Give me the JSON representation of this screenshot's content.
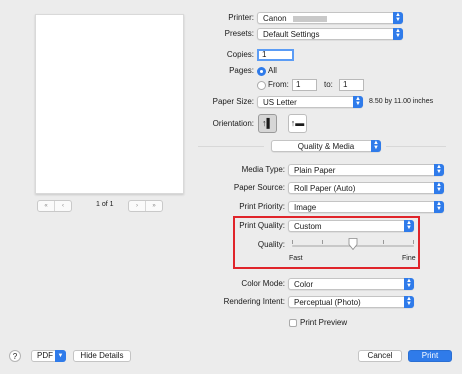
{
  "preview": {
    "page_label": "1 of 1",
    "first_glyph": "«",
    "prev_glyph": "‹",
    "next_glyph": "›",
    "last_glyph": "»"
  },
  "printer": {
    "label": "Printer:",
    "value": "Canon"
  },
  "presets": {
    "label": "Presets:",
    "value": "Default Settings"
  },
  "copies": {
    "label": "Copies:",
    "value": "1"
  },
  "pages": {
    "label": "Pages:",
    "all_label": "All",
    "from_label": "From:",
    "from_value": "1",
    "to_label": "to:",
    "to_value": "1"
  },
  "paper_size": {
    "label": "Paper Size:",
    "value": "US Letter",
    "dimensions": "8.50 by 11.00 inches"
  },
  "orientation": {
    "label": "Orientation:",
    "portrait_icon": "portrait-person-icon",
    "landscape_icon": "landscape-person-icon"
  },
  "section": {
    "value": "Quality & Media"
  },
  "media_type": {
    "label": "Media Type:",
    "value": "Plain Paper"
  },
  "paper_source": {
    "label": "Paper Source:",
    "value": "Roll Paper (Auto)"
  },
  "print_priority": {
    "label": "Print Priority:",
    "value": "Image"
  },
  "print_quality": {
    "label": "Print Quality:",
    "value": "Custom"
  },
  "quality": {
    "label": "Quality:",
    "min_label": "Fast",
    "max_label": "Fine",
    "level": 0.5
  },
  "color_mode": {
    "label": "Color Mode:",
    "value": "Color"
  },
  "rendering_intent": {
    "label": "Rendering Intent:",
    "value": "Perceptual (Photo)"
  },
  "print_preview": {
    "label": "Print Preview",
    "checked": false
  },
  "footer": {
    "help_label": "?",
    "pdf_label": "PDF",
    "hide_details_label": "Hide Details",
    "cancel_label": "Cancel",
    "print_label": "Print"
  },
  "colors": {
    "accent": "#2f7bea",
    "highlight_box": "#e0242a"
  }
}
